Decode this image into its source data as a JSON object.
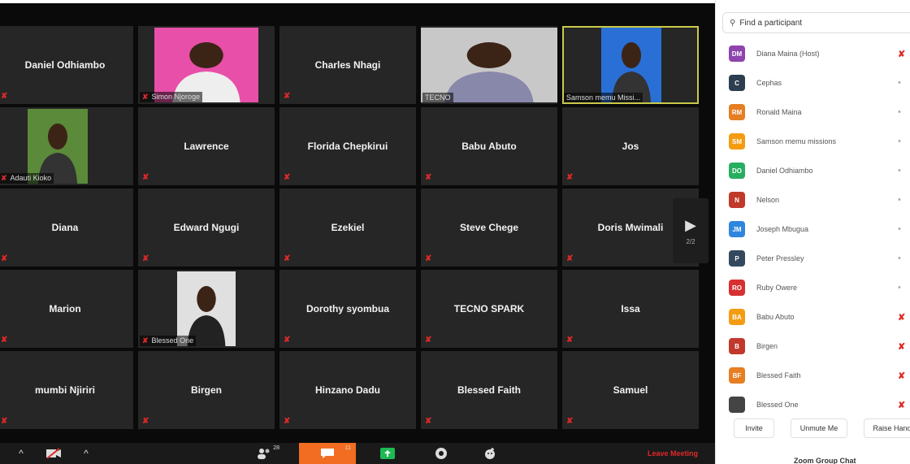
{
  "gallery": {
    "tiles": [
      {
        "name": "Daniel Odhiambo",
        "kind": "name"
      },
      {
        "name": "",
        "kind": "photo",
        "label": "Simon Njoroge",
        "muted": true
      },
      {
        "name": "Charles Nhagi",
        "kind": "name"
      },
      {
        "name": "",
        "kind": "photo",
        "label": "TECNO",
        "muted": false
      },
      {
        "name": "",
        "kind": "photo",
        "label": "Samson memu Missi...",
        "muted": false,
        "active": true
      },
      {
        "name": "",
        "kind": "photo",
        "label": "Adauti Kioko",
        "muted": true
      },
      {
        "name": "Lawrence",
        "kind": "name"
      },
      {
        "name": "Florida Chepkirui",
        "kind": "name"
      },
      {
        "name": "Babu Abuto",
        "kind": "name"
      },
      {
        "name": "Jos",
        "kind": "name"
      },
      {
        "name": "Diana",
        "kind": "name"
      },
      {
        "name": "Edward Ngugi",
        "kind": "name"
      },
      {
        "name": "Ezekiel",
        "kind": "name"
      },
      {
        "name": "Steve Chege",
        "kind": "name"
      },
      {
        "name": "Doris Mwimali",
        "kind": "name"
      },
      {
        "name": "Marion",
        "kind": "name"
      },
      {
        "name": "",
        "kind": "photo",
        "label": "Blessed One",
        "muted": true
      },
      {
        "name": "Dorothy syombua",
        "kind": "name"
      },
      {
        "name": "TECNO SPARK",
        "kind": "name"
      },
      {
        "name": "Issa",
        "kind": "name"
      },
      {
        "name": "mumbi Njiriri",
        "kind": "name"
      },
      {
        "name": "Birgen",
        "kind": "name"
      },
      {
        "name": "Hinzano Dadu",
        "kind": "name"
      },
      {
        "name": "Blessed Faith",
        "kind": "name"
      },
      {
        "name": "Samuel",
        "kind": "name"
      }
    ],
    "next_page_arrow": "▶",
    "page_indicator": "2/2"
  },
  "toolbar": {
    "participants_count": "28",
    "chat_count": "11",
    "leave_label": "Leave Meeting"
  },
  "panel": {
    "search_placeholder": "Find a participant",
    "participants": [
      {
        "initials": "DM",
        "name": "Diana Maina (Host)",
        "color": "#8e44ad",
        "mic": "off"
      },
      {
        "initials": "C",
        "name": "Cephas",
        "color": "#2c3e50",
        "mic": "on"
      },
      {
        "initials": "RM",
        "name": "Ronald Maina",
        "color": "#e67e22",
        "mic": "on"
      },
      {
        "initials": "SM",
        "name": "Samson memu missions",
        "color": "#f39c12",
        "mic": "on"
      },
      {
        "initials": "DO",
        "name": "Daniel Odhiambo",
        "color": "#27ae60",
        "mic": "on"
      },
      {
        "initials": "N",
        "name": "Nelson",
        "color": "#c0392b",
        "mic": "on"
      },
      {
        "initials": "JM",
        "name": "Joseph Mbugua",
        "color": "#2e86de",
        "mic": "on"
      },
      {
        "initials": "P",
        "name": "Peter Pressley",
        "color": "#34495e",
        "mic": "on"
      },
      {
        "initials": "RO",
        "name": "Ruby Owere",
        "color": "#d63031",
        "mic": "on"
      },
      {
        "initials": "BA",
        "name": "Babu Abuto",
        "color": "#f39c12",
        "mic": "off"
      },
      {
        "initials": "B",
        "name": "Birgen",
        "color": "#c0392b",
        "mic": "off"
      },
      {
        "initials": "BF",
        "name": "Blessed Faith",
        "color": "#e67e22",
        "mic": "off"
      },
      {
        "initials": "",
        "name": "Blessed One",
        "color": "#444444",
        "mic": "off"
      }
    ],
    "actions": {
      "invite": "Invite",
      "unmute_me": "Unmute Me",
      "raise_hand": "Raise Hand"
    },
    "footer": "Zoom Group Chat"
  },
  "colors": {
    "chat_accent": "#f26d21",
    "mute_red": "#e02828",
    "active_border": "#c9c94a"
  }
}
